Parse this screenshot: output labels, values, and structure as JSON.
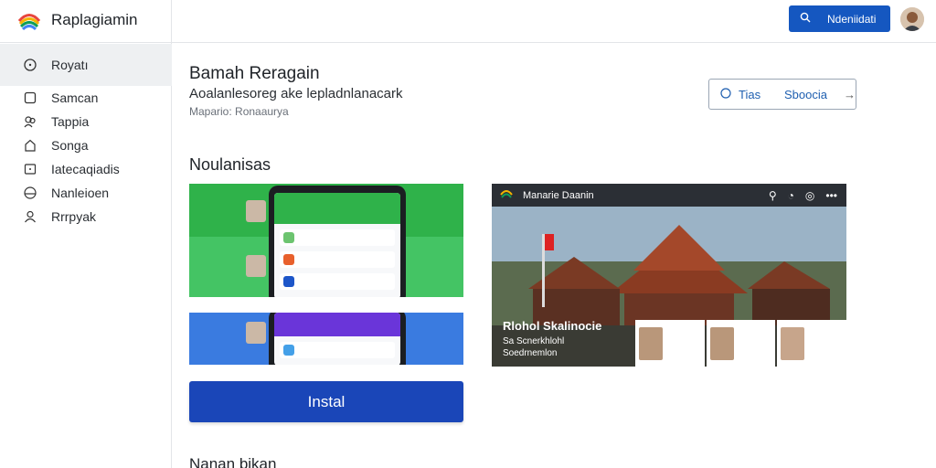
{
  "app": {
    "name": "Raplagiamin"
  },
  "sidebar": {
    "items": [
      {
        "label": "Royatı",
        "icon": "clock-icon"
      },
      {
        "label": "Samcan",
        "icon": "square-icon"
      },
      {
        "label": "Tappia",
        "icon": "users-icon"
      },
      {
        "label": "Songa",
        "icon": "home-icon"
      },
      {
        "label": "Iatecaqiadis",
        "icon": "box-icon"
      },
      {
        "label": "Nanleioen",
        "icon": "circle-icon"
      },
      {
        "label": "Rrrpyak",
        "icon": "person-icon"
      }
    ]
  },
  "topbar": {
    "button_label": "Ndeniidati",
    "button_icon": "search-icon"
  },
  "header": {
    "title": "Bamah Reragain",
    "subtitle": "Aoalanlesoreg ake lepladnlanacark",
    "meta": "Mapario: Ronaaurya"
  },
  "outline_button": {
    "left": "Tias",
    "right": "Sboocia"
  },
  "section": {
    "title": "Noulanisas"
  },
  "video": {
    "bar_title": "Manarie Daanin",
    "caption_title": "Rlohol Skalinocie",
    "caption_line2": "Sa Scnerkhlohl",
    "caption_line3": "Soedrnemlon"
  },
  "install": {
    "label": "Instal"
  },
  "bottom": {
    "title": "Nanan bikan"
  },
  "colors": {
    "primary": "#1557c0",
    "install": "#1a46b8",
    "green": "#2fb24a",
    "blue": "#3a7be0"
  }
}
